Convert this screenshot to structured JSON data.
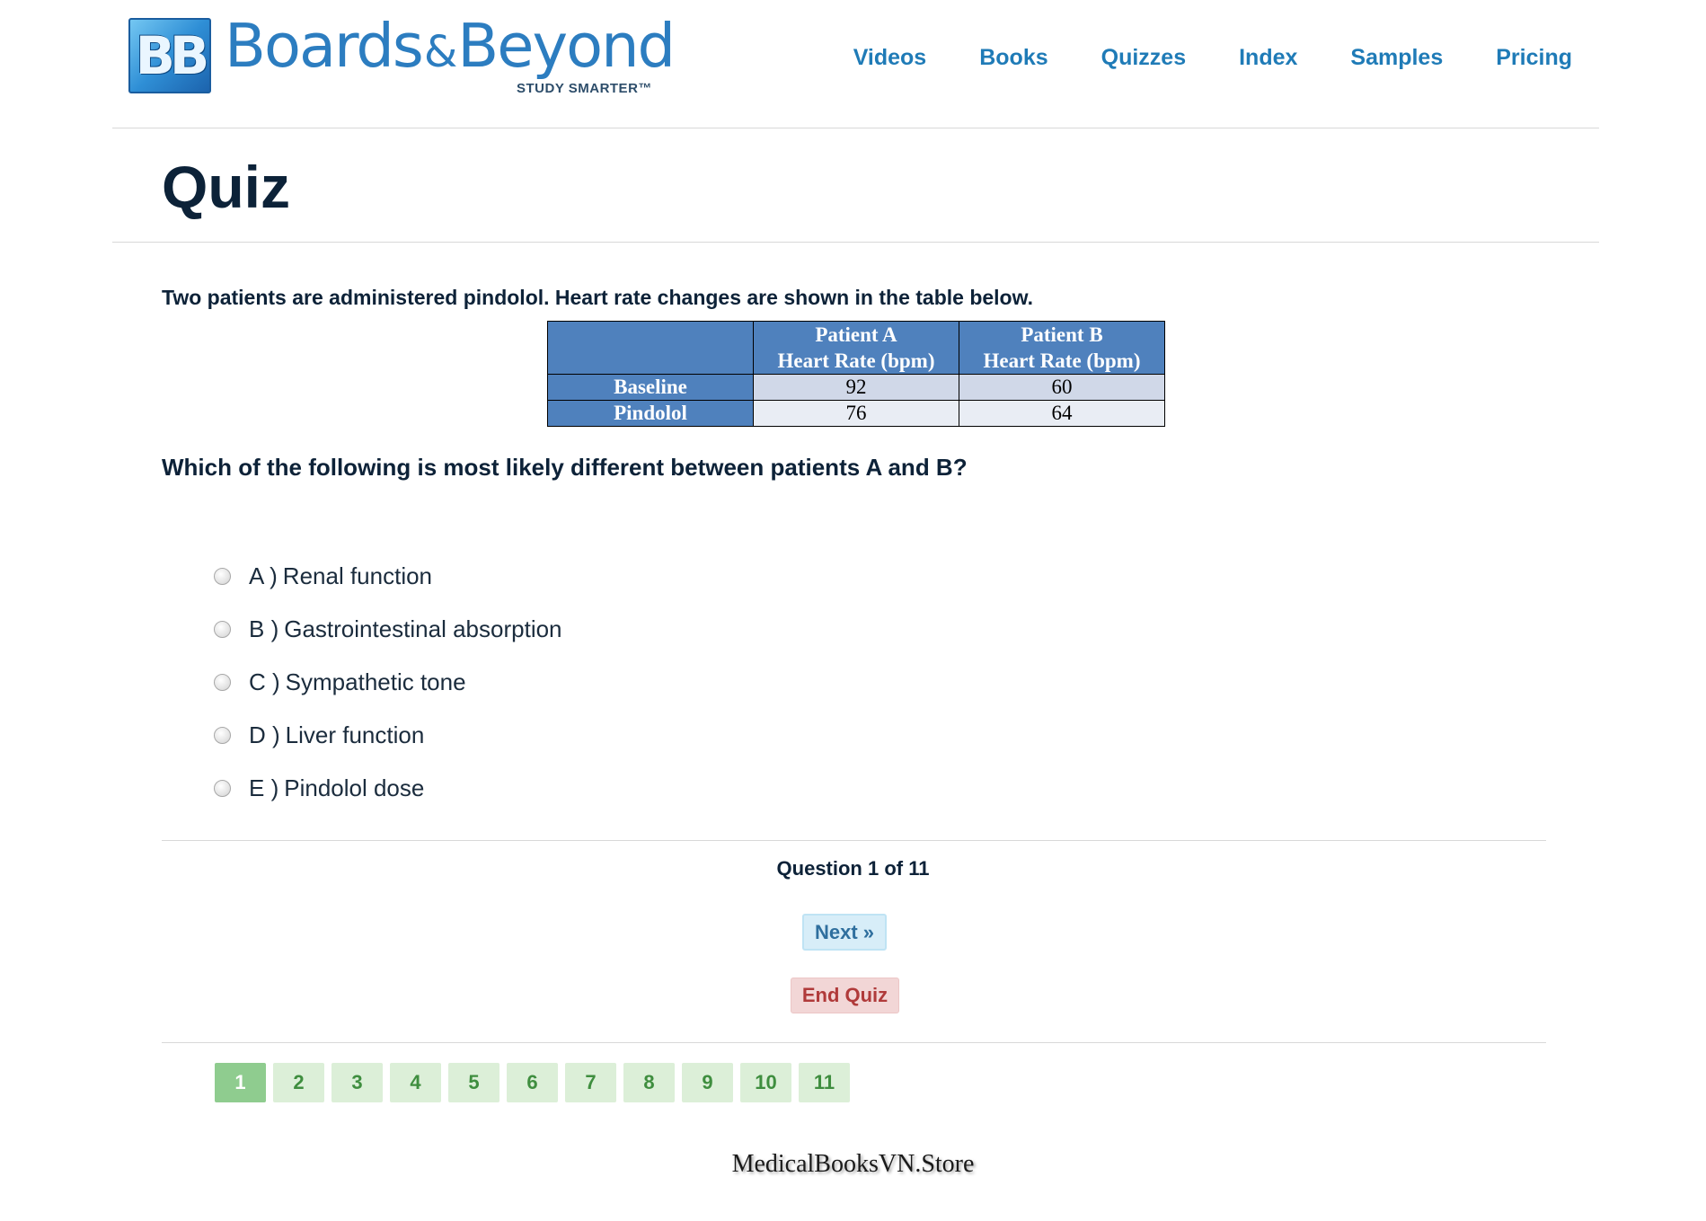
{
  "brand": {
    "badge": "BB",
    "name_part1": "Boards",
    "amp": "&",
    "name_part2": "Beyond",
    "tagline": "STUDY SMARTER™"
  },
  "nav": [
    "Videos",
    "Books",
    "Quizzes",
    "Index",
    "Samples",
    "Pricing"
  ],
  "page_title": "Quiz",
  "question": {
    "stem": "Two patients are administered pindolol. Heart rate changes are shown in the table below.",
    "table": {
      "headers": [
        {
          "line1": "Patient A",
          "line2": "Heart Rate (bpm)"
        },
        {
          "line1": "Patient B",
          "line2": "Heart Rate (bpm)"
        }
      ],
      "rows": [
        {
          "label": "Baseline",
          "a": "92",
          "b": "60"
        },
        {
          "label": "Pindolol",
          "a": "76",
          "b": "64"
        }
      ]
    },
    "prompt": "Which of the following is most likely different between patients A and B?",
    "options": [
      {
        "letter": "A )",
        "text": "Renal function"
      },
      {
        "letter": "B )",
        "text": "Gastrointestinal absorption"
      },
      {
        "letter": "C )",
        "text": "Sympathetic tone"
      },
      {
        "letter": "D )",
        "text": "Liver function"
      },
      {
        "letter": "E )",
        "text": "Pindolol dose"
      }
    ]
  },
  "counter": "Question 1 of 11",
  "buttons": {
    "next": "Next »",
    "end": "End Quiz"
  },
  "pager": [
    "1",
    "2",
    "3",
    "4",
    "5",
    "6",
    "7",
    "8",
    "9",
    "10",
    "11"
  ],
  "current_page": "1",
  "watermark": "MedicalBooksVN.Store",
  "colors": {
    "nav_link": "#1f7bb7",
    "table_header": "#4f81bd",
    "next_bg": "#d7edf8",
    "end_bg": "#f2d6d6",
    "pager_active": "#8fcc8f",
    "pager_inactive": "#dcefd8"
  }
}
